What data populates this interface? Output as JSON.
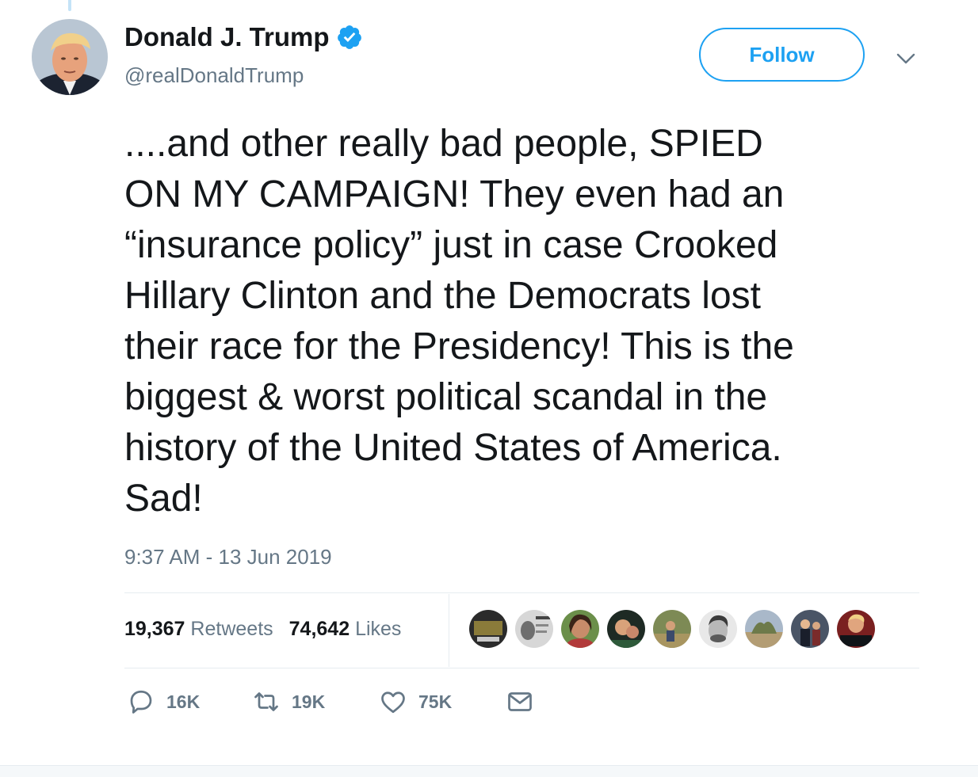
{
  "author": {
    "display_name": "Donald J. Trump",
    "handle": "@realDonaldTrump",
    "verified": true,
    "verified_color": "#1da1f2"
  },
  "follow_button": {
    "label": "Follow"
  },
  "tweet": {
    "lines": [
      "....and other really bad people, SPIED",
      "ON MY CAMPAIGN! They even had an",
      "“insurance policy” just in case Crooked",
      "Hillary Clinton and the Democrats lost",
      "their race for the Presidency! This is the",
      "biggest & worst political scandal in the",
      "history of the United States of America.",
      "Sad!"
    ],
    "timestamp": "9:37 AM - 13 Jun 2019"
  },
  "stats": {
    "retweets_count": "19,367",
    "retweets_label": "Retweets",
    "likes_count": "74,642",
    "likes_label": "Likes"
  },
  "actions": {
    "reply_count": "16K",
    "retweet_count": "19K",
    "like_count": "75K"
  },
  "icons": {
    "verified": "verified-badge-icon",
    "caret": "chevron-down-icon",
    "reply": "reply-icon",
    "retweet": "retweet-icon",
    "like": "heart-icon",
    "dm": "envelope-icon"
  },
  "colors": {
    "accent": "#1da1f2",
    "text": "#14171a",
    "secondary_text": "#657786",
    "divider": "#e6ecf0"
  }
}
